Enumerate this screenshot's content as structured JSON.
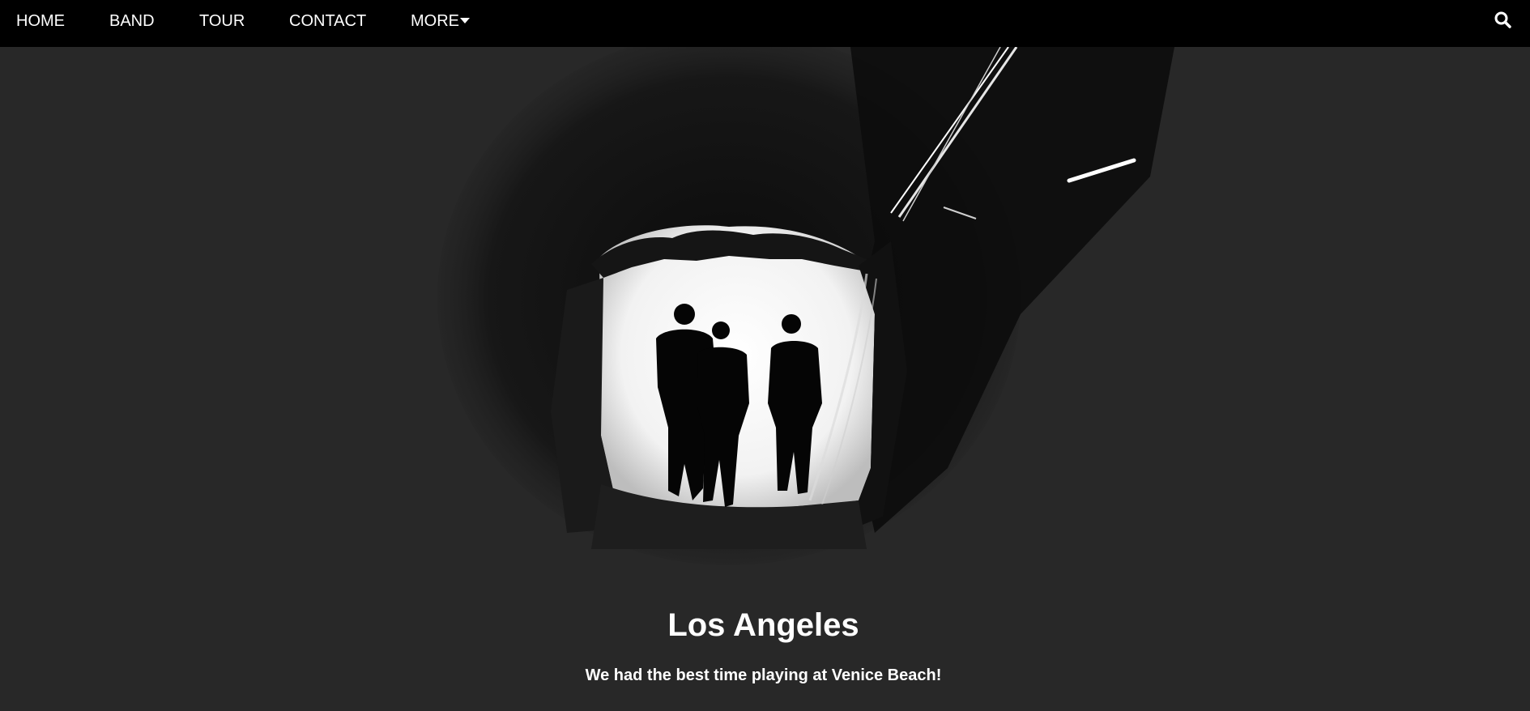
{
  "nav": {
    "items": [
      {
        "label": "HOME"
      },
      {
        "label": "BAND"
      },
      {
        "label": "TOUR"
      },
      {
        "label": "CONTACT"
      },
      {
        "label": "MORE"
      }
    ],
    "more_icon": "caret-down-icon",
    "search_icon": "search-icon"
  },
  "hero": {
    "title": "Los Angeles",
    "text": "We had the best time playing at Venice Beach!"
  },
  "colors": {
    "nav_bg": "#000000",
    "page_bg": "#282828",
    "text": "#ffffff"
  }
}
